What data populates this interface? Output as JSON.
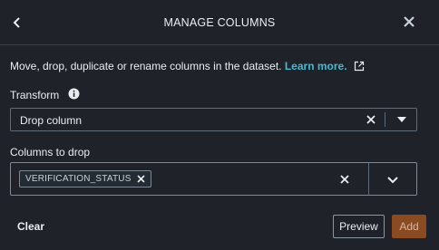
{
  "header": {
    "title": "MANAGE COLUMNS",
    "back_icon": "chevron-left-icon",
    "close_icon": "close-icon"
  },
  "description": {
    "text": "Move, drop, duplicate or rename columns in the dataset.",
    "link_label": "Learn more.",
    "link_icon": "external-link-icon"
  },
  "transform": {
    "label": "Transform",
    "info_icon": "info-icon",
    "selected": "Drop column"
  },
  "columns_to_drop": {
    "label": "Columns to drop",
    "tokens": [
      "VERIFICATION_STATUS"
    ]
  },
  "footer": {
    "clear_label": "Clear",
    "preview_label": "Preview",
    "add_label": "Add"
  },
  "colors": {
    "background": "#1f2329",
    "link": "#44b9d6",
    "focus_border": "#2ea8c8",
    "add_button": "#8a4a22"
  }
}
